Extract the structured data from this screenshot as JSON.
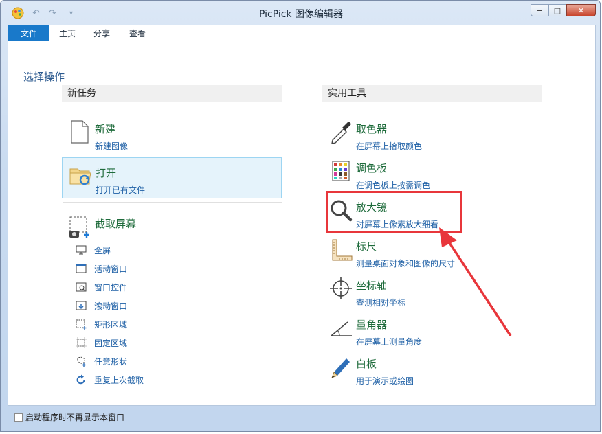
{
  "window": {
    "title": "PicPick 图像编辑器",
    "controls": {
      "minimize": "−",
      "restore": "□",
      "close": "✕"
    }
  },
  "quick_access": {
    "undo": "↶",
    "redo": "↷",
    "customize": "▾"
  },
  "ribbon": {
    "tabs": [
      {
        "label": "文件",
        "active": true
      },
      {
        "label": "主页",
        "active": false
      },
      {
        "label": "分享",
        "active": false
      },
      {
        "label": "查看",
        "active": false
      }
    ]
  },
  "content": {
    "section_title": "选择操作",
    "left_column": {
      "header": "新任务",
      "items": [
        {
          "title": "新建",
          "subtitle": "新建图像",
          "icon": "new-file-icon"
        },
        {
          "title": "打开",
          "subtitle": "打开已有文件",
          "icon": "open-folder-icon",
          "selected": true
        }
      ],
      "capture": {
        "title": "截取屏幕",
        "icon": "screen-capture-icon",
        "options": [
          {
            "label": "全屏",
            "icon": "fullscreen-icon"
          },
          {
            "label": "活动窗口",
            "icon": "active-window-icon"
          },
          {
            "label": "窗口控件",
            "icon": "window-control-icon"
          },
          {
            "label": "滚动窗口",
            "icon": "scroll-window-icon"
          },
          {
            "label": "矩形区域",
            "icon": "rectangle-region-icon"
          },
          {
            "label": "固定区域",
            "icon": "fixed-region-icon"
          },
          {
            "label": "任意形状",
            "icon": "freehand-shape-icon"
          },
          {
            "label": "重复上次截取",
            "icon": "repeat-capture-icon"
          }
        ]
      }
    },
    "right_column": {
      "header": "实用工具",
      "items": [
        {
          "title": "取色器",
          "subtitle": "在屏幕上拾取颜色",
          "icon": "eyedropper-icon"
        },
        {
          "title": "调色板",
          "subtitle": "在调色板上按需调色",
          "icon": "color-palette-icon"
        },
        {
          "title": "放大镜",
          "subtitle": "对屏幕上像素放大细看",
          "icon": "magnifier-icon",
          "highlighted": true
        },
        {
          "title": "标尺",
          "subtitle": "测量桌面对象和图像的尺寸",
          "icon": "ruler-icon"
        },
        {
          "title": "坐标轴",
          "subtitle": "查测相对坐标",
          "icon": "crosshair-icon"
        },
        {
          "title": "量角器",
          "subtitle": "在屏幕上测量角度",
          "icon": "protractor-icon"
        },
        {
          "title": "白板",
          "subtitle": "用于演示或绘图",
          "icon": "whiteboard-pen-icon"
        }
      ]
    }
  },
  "footer": {
    "checkbox_label": "启动程序时不再显示本窗口",
    "checked": false
  },
  "colors": {
    "accent": "#1979ca",
    "title_green": "#1e6b3b",
    "link_blue": "#1d5fa5",
    "highlight_red": "#e8363b"
  }
}
